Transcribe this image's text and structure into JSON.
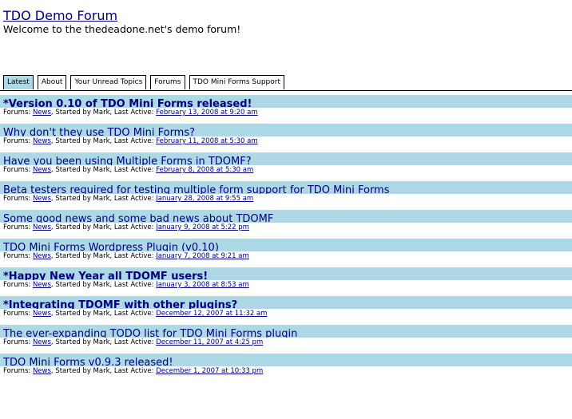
{
  "site": {
    "title": "TDO Demo Forum",
    "tagline": "Welcome to the thedeadone.net's demo forum!"
  },
  "tabs": [
    {
      "label": "Latest",
      "active": true
    },
    {
      "label": "About",
      "active": false
    },
    {
      "label": "Your Unread Topics",
      "active": false
    },
    {
      "label": "Forums",
      "active": false
    },
    {
      "label": "TDO Mini Forms Support",
      "active": false
    }
  ],
  "meta_labels": {
    "forums": "Forums: ",
    "started_by": ", Started by ",
    "last_active": ", Last Active: "
  },
  "topics": [
    {
      "title": "*Version 0.10 of TDO Mini Forms released!",
      "forum": "News",
      "author": "Mark",
      "last_active": "February 13, 2008 at 9:20 am"
    },
    {
      "title": "Why don't they use TDO Mini Forms?",
      "forum": "News",
      "author": "Mark",
      "last_active": "February 11, 2008 at 5:30 am"
    },
    {
      "title": "Have you been using Multiple Forms in TDOMF?",
      "forum": "News",
      "author": "Mark",
      "last_active": "February 8, 2008 at 5:30 am"
    },
    {
      "title": "Beta testers required for testing multiple form support for TDO Mini Forms",
      "forum": "News",
      "author": "Mark",
      "last_active": "January 28, 2008 at 9:55 am"
    },
    {
      "title": "Some good news and some bad news about TDOMF",
      "forum": "News",
      "author": "Mark",
      "last_active": "January 9, 2008 at 5:22 pm"
    },
    {
      "title": "TDO Mini Forms Wordpress Plugin (v0.10)",
      "forum": "News",
      "author": "Mark",
      "last_active": "January 7, 2008 at 9:21 am"
    },
    {
      "title": "*Happy New Year all TDOMF users!",
      "forum": "News",
      "author": "Mark",
      "last_active": "January 3, 2008 at 8:53 am"
    },
    {
      "title": "*Integrating TDOMF with other plugins?",
      "forum": "News",
      "author": "Mark",
      "last_active": "December 12, 2007 at 11:32 am"
    },
    {
      "title": "The ever-expanding TODO list for TDO Mini Forms plugin",
      "forum": "News",
      "author": "Mark",
      "last_active": "December 11, 2007 at 4:25 pm"
    },
    {
      "title": "TDO Mini Forms v0.9.3 released!",
      "forum": "News",
      "author": "Mark",
      "last_active": "December 1, 2007 at 10:33 pm"
    }
  ],
  "colors": {
    "row_highlight": "#add8e6",
    "link": "#00007f"
  }
}
